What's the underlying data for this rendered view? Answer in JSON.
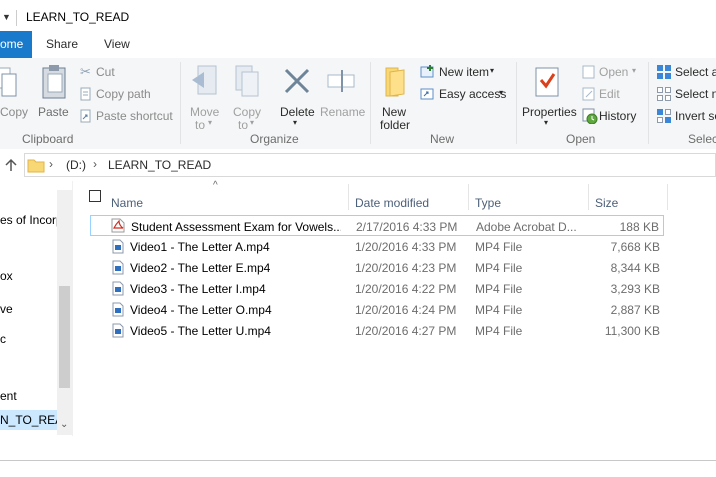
{
  "window": {
    "title": "LEARN_TO_READ",
    "ribbon_tabs": [
      "ome",
      "Share",
      "View"
    ]
  },
  "ribbon": {
    "clipboard": {
      "copy": "Copy",
      "paste": "Paste",
      "cut": "Cut",
      "copy_path": "Copy path",
      "paste_shortcut": "Paste shortcut",
      "label": "Clipboard"
    },
    "organize": {
      "move_to": "Move",
      "move_to_2": "to",
      "copy_to": "Copy",
      "copy_to_2": "to",
      "delete": "Delete",
      "rename": "Rename",
      "label": "Organize"
    },
    "new": {
      "new_folder": "New",
      "new_folder_2": "folder",
      "new_item": "New item",
      "easy_access": "Easy access",
      "label": "New"
    },
    "open": {
      "properties": "Properties",
      "open": "Open",
      "edit": "Edit",
      "history": "History",
      "label": "Open"
    },
    "select": {
      "select_all": "Select al",
      "select_none": "Select n",
      "invert": "Invert se",
      "label": "Selec"
    }
  },
  "address": {
    "drive": "(D:)",
    "folder": "LEARN_TO_READ"
  },
  "nav_pane": {
    "items": [
      "es of Incorp",
      "ox",
      "ve",
      "c",
      "ent",
      "N_TO_REAL"
    ]
  },
  "columns": {
    "name": "Name",
    "date": "Date modified",
    "type": "Type",
    "size": "Size"
  },
  "files": [
    {
      "name": "Student Assessment Exam for Vowels....",
      "date": "2/17/2016 4:33 PM",
      "type": "Adobe Acrobat D...",
      "size": "188 KB",
      "icon": "pdf-icon"
    },
    {
      "name": "Video1 - The Letter A.mp4",
      "date": "1/20/2016 4:33 PM",
      "type": "MP4 File",
      "size": "7,668 KB",
      "icon": "video-file-icon"
    },
    {
      "name": "Video2 - The Letter E.mp4",
      "date": "1/20/2016 4:23 PM",
      "type": "MP4 File",
      "size": "8,344 KB",
      "icon": "video-file-icon"
    },
    {
      "name": "Video3 - The Letter I.mp4",
      "date": "1/20/2016 4:22 PM",
      "type": "MP4 File",
      "size": "3,293 KB",
      "icon": "video-file-icon"
    },
    {
      "name": "Video4 - The Letter O.mp4",
      "date": "1/20/2016 4:24 PM",
      "type": "MP4 File",
      "size": "2,887 KB",
      "icon": "video-file-icon"
    },
    {
      "name": "Video5 - The Letter U.mp4",
      "date": "1/20/2016 4:27 PM",
      "type": "MP4 File",
      "size": "11,300 KB",
      "icon": "video-file-icon"
    }
  ]
}
